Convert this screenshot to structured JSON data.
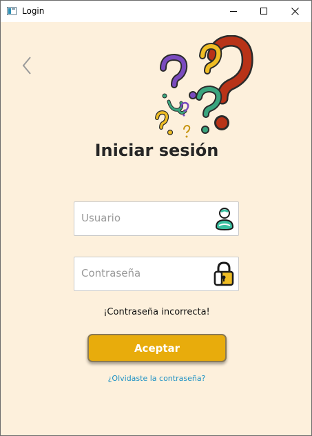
{
  "window": {
    "title": "Login"
  },
  "header": {
    "title": "Iniciar sesión"
  },
  "form": {
    "username_placeholder": "Usuario",
    "password_placeholder": "Contraseña",
    "error_message": "¡Contraseña incorrecta!",
    "submit_label": "Aceptar",
    "forgot_link": "¿Olvidaste la contraseña?"
  },
  "icons": {
    "back": "chevron-left-icon",
    "user": "user-icon",
    "lock": "lock-icon",
    "illustration": "question-marks-illustration"
  },
  "colors": {
    "background": "#fdf0dc",
    "accent": "#e8ac0c",
    "link": "#1a8fc4",
    "title": "#262626"
  }
}
